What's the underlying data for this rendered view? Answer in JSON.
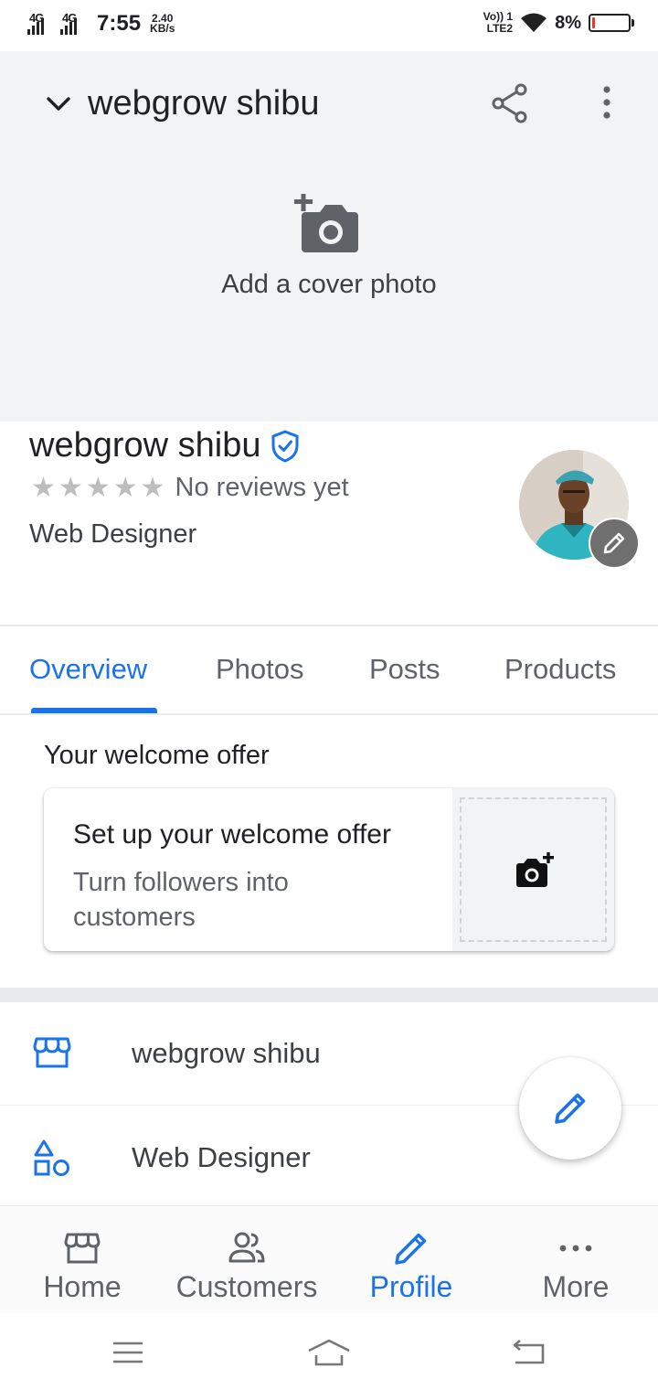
{
  "status_bar": {
    "network1": "4G",
    "network2": "4G",
    "time": "7:55",
    "speed_value": "2.40",
    "speed_unit": "KB/s",
    "volte_line1": "Vo)) 1",
    "volte_line2": "LTE2",
    "battery_percent": "8%",
    "battery_level": 0.08,
    "battery_color": "#e53935"
  },
  "header": {
    "title": "webgrow shibu",
    "icons": [
      "chevron-down-icon",
      "share-icon",
      "more-vert-icon"
    ]
  },
  "cover": {
    "add_label": "Add a cover photo",
    "icon": "add-a-photo-icon"
  },
  "business": {
    "name": "webgrow shibu",
    "verified_icon": "verified-shield-icon",
    "reviews_text": "No reviews yet",
    "star_count": 5,
    "category": "Web Designer"
  },
  "tabs": [
    {
      "label": "Overview",
      "active": true
    },
    {
      "label": "Photos",
      "active": false
    },
    {
      "label": "Posts",
      "active": false
    },
    {
      "label": "Products",
      "active": false
    }
  ],
  "welcome_offer": {
    "section_title": "Your welcome offer",
    "card_title": "Set up your welcome offer",
    "card_subtitle": "Turn followers into customers",
    "icon": "add-a-photo-icon"
  },
  "info_rows": [
    {
      "icon": "storefront-icon",
      "text": "webgrow shibu"
    },
    {
      "icon": "category-icon",
      "text": "Web Designer"
    }
  ],
  "fab": {
    "icon": "edit-pencil-icon"
  },
  "bottom_nav": [
    {
      "label": "Home",
      "icon": "storefront-icon",
      "active": false
    },
    {
      "label": "Customers",
      "icon": "people-icon",
      "active": false
    },
    {
      "label": "Profile",
      "icon": "edit-pencil-icon",
      "active": true
    },
    {
      "label": "More",
      "icon": "more-horiz-icon",
      "active": false
    }
  ],
  "system_nav": [
    "menu-icon",
    "home-icon",
    "back-icon"
  ],
  "colors": {
    "accent": "#1a73e8",
    "cover_bg": "#f1f3f4",
    "text_primary": "#202124",
    "text_secondary": "#5f6368"
  }
}
